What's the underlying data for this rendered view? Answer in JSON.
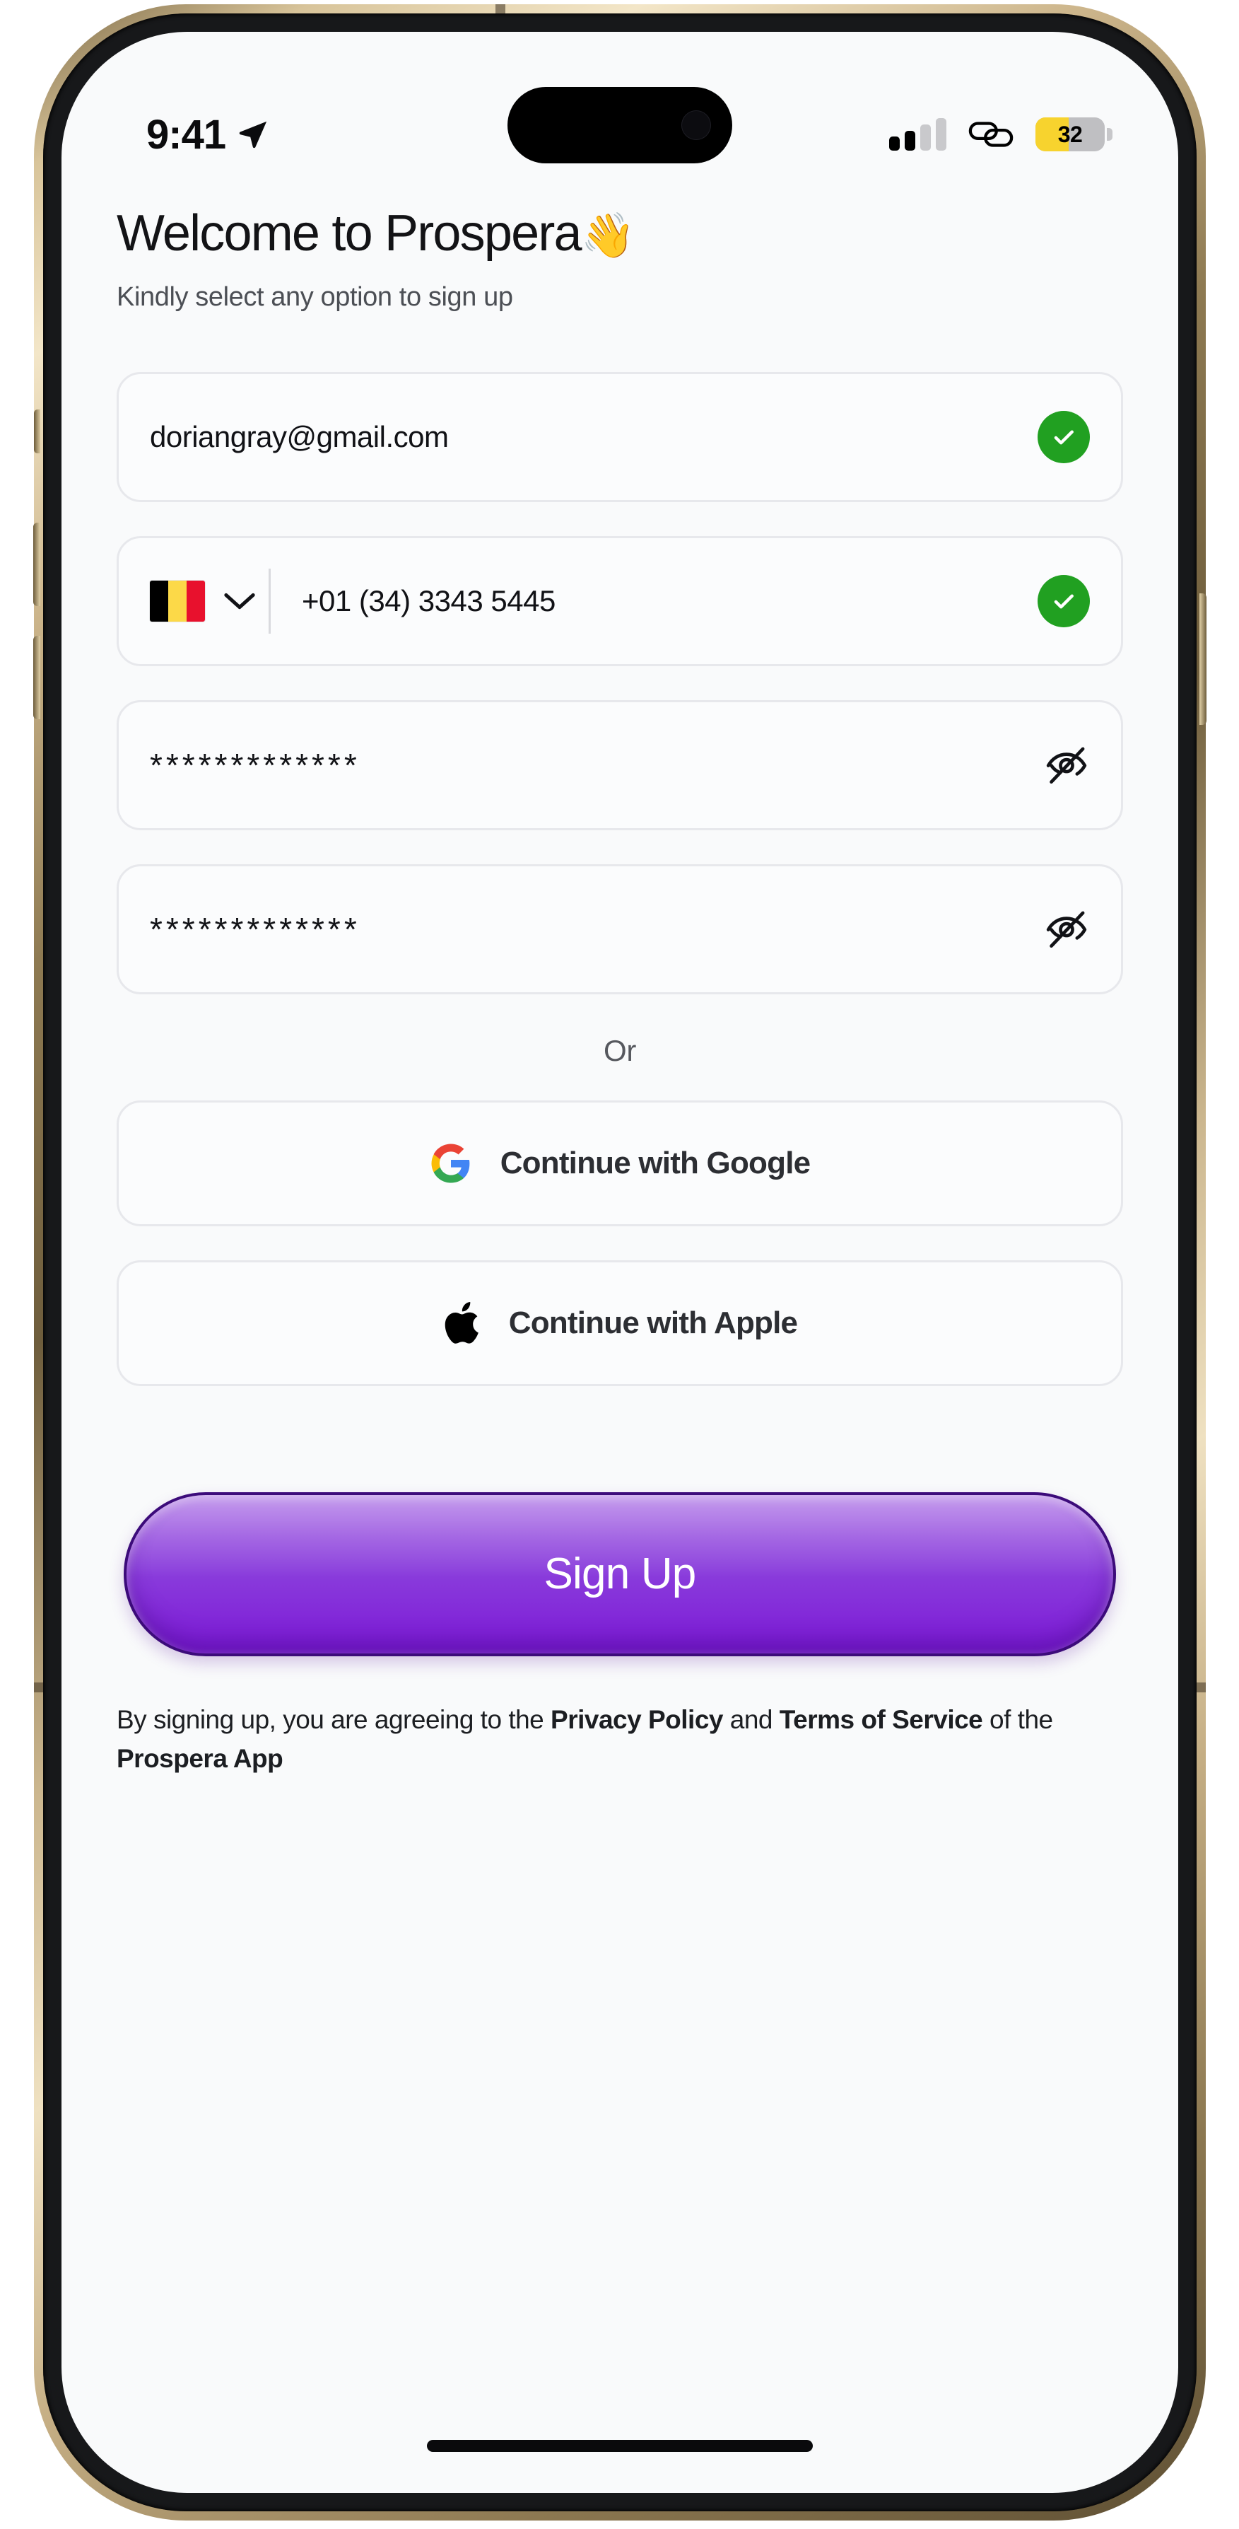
{
  "status_bar": {
    "time": "9:41",
    "location_icon": "location-arrow-icon",
    "signal_icon": "cellular-signal-icon",
    "signal_bars_filled": 2,
    "signal_bars_total": 4,
    "link_icon": "link-chain-icon",
    "battery_level": "32",
    "battery_color": "#f7d32e"
  },
  "header": {
    "title": "Welcome to Prospera",
    "title_emoji": "👋",
    "subtitle": "Kindly select any option to sign up"
  },
  "form": {
    "email": {
      "value": "doriangray@gmail.com",
      "placeholder": "Email address",
      "status_icon": "check-circle-icon",
      "status_color": "#21a021"
    },
    "phone": {
      "country_flag": "belgium-flag-icon",
      "dropdown_icon": "chevron-down-icon",
      "value": "+01 (34) 3343 5445",
      "placeholder": "Phone number",
      "status_icon": "check-circle-icon",
      "status_color": "#21a021"
    },
    "password": {
      "value": "*************",
      "placeholder": "Password",
      "toggle_icon": "eye-off-icon"
    },
    "confirm_password": {
      "value": "*************",
      "placeholder": "Confirm password",
      "toggle_icon": "eye-off-icon"
    }
  },
  "divider": {
    "label": "Or"
  },
  "social": {
    "google": {
      "label": "Continue with Google",
      "icon": "google-logo-icon"
    },
    "apple": {
      "label": "Continue with Apple",
      "icon": "apple-logo-icon"
    }
  },
  "cta": {
    "label": "Sign Up",
    "accent_color": "#8b3fdc",
    "border_color": "#3c0b7a"
  },
  "legal": {
    "prefix": "By signing up, you are agreeing to the ",
    "privacy_policy": "Privacy Policy",
    "conjunction": " and ",
    "terms_of_service": "Terms of Service",
    "middle": " of the ",
    "app_name": "Prospera App"
  }
}
